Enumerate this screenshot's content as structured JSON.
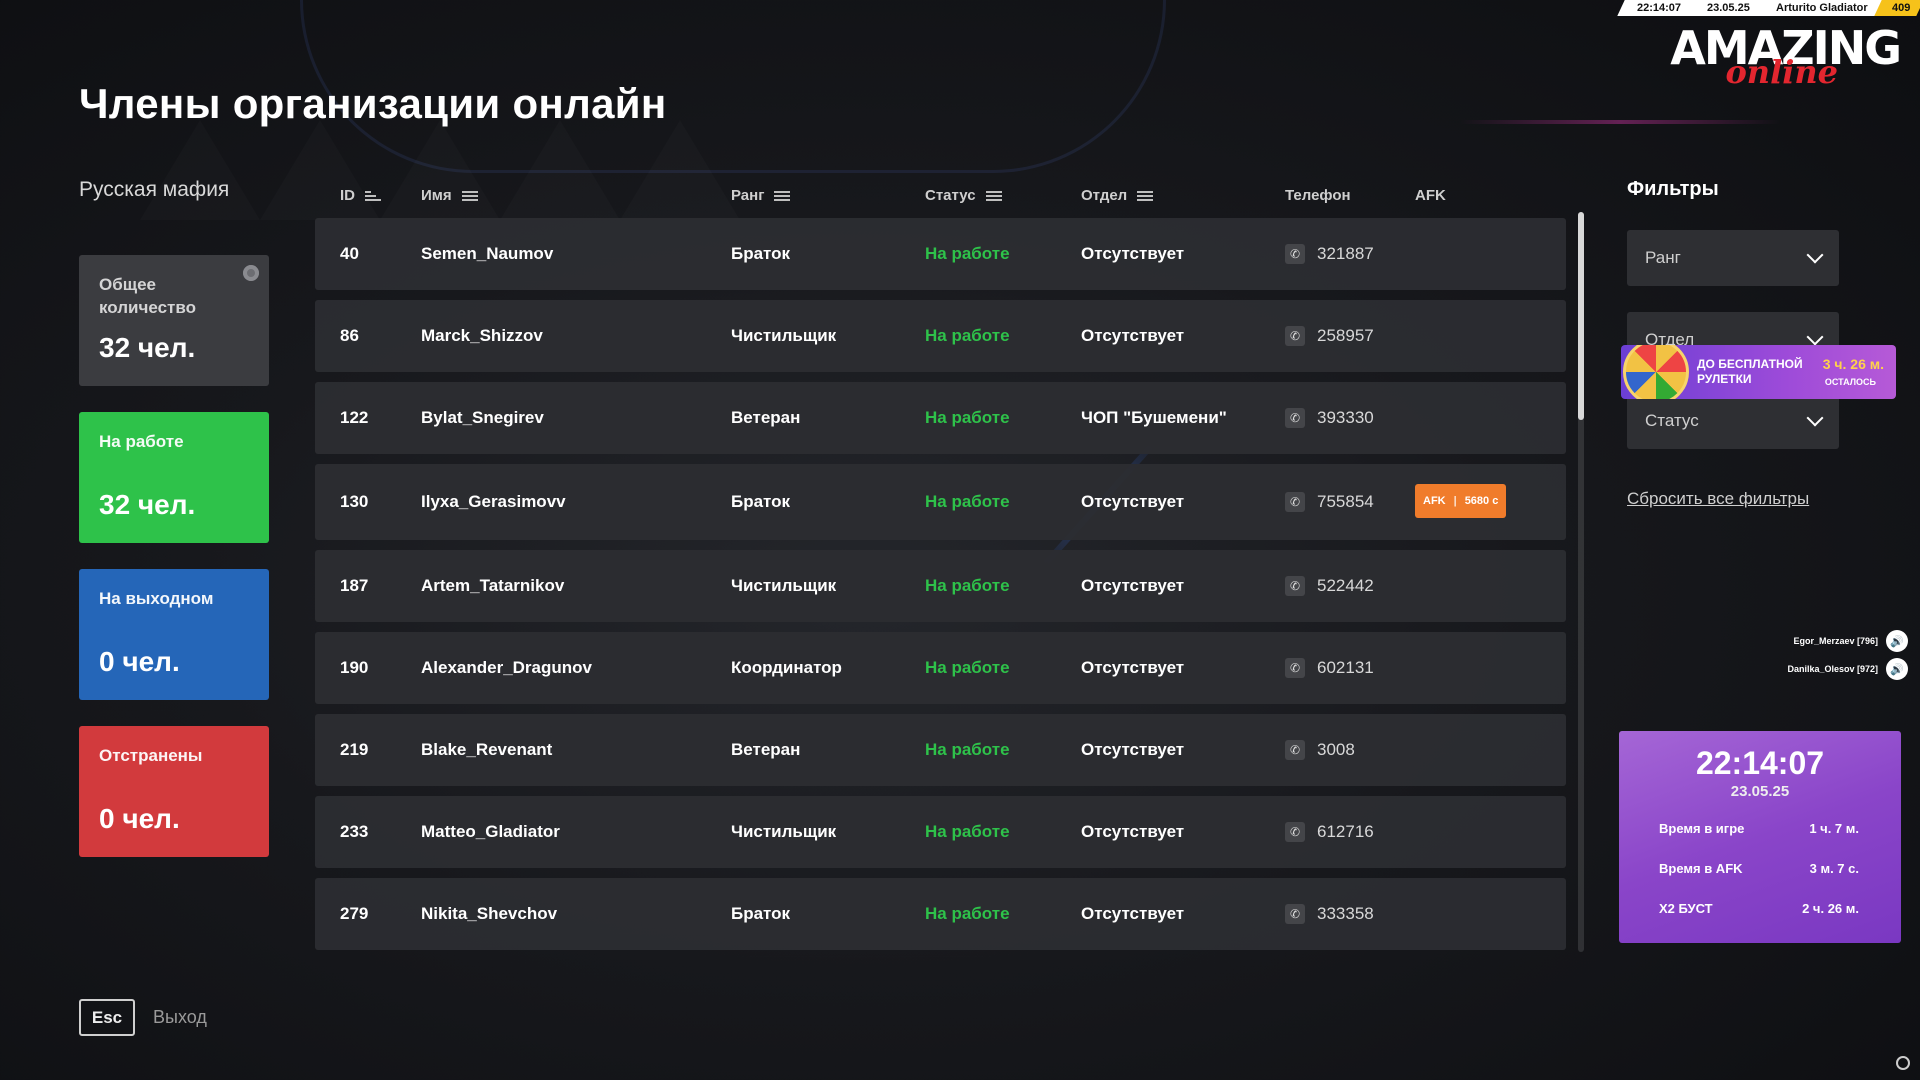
{
  "hud": {
    "time": "22:14:07",
    "date": "23.05.25",
    "player": "Arturito Gladiator",
    "id": "409"
  },
  "logo": {
    "line1": "AMAZING",
    "line2": "online"
  },
  "page": {
    "title": "Члены организации онлайн",
    "org_name": "Русская мафия"
  },
  "stats": {
    "total": {
      "label": "Общее количество",
      "value": "32 чел."
    },
    "working": {
      "label": "На работе",
      "value": "32 чел."
    },
    "off": {
      "label": "На выходном",
      "value": "0 чел."
    },
    "banned": {
      "label": "Отстранены",
      "value": "0 чел."
    }
  },
  "columns": {
    "id": "ID",
    "name": "Имя",
    "rank": "Ранг",
    "status": "Статус",
    "dept": "Отдел",
    "phone": "Телефон",
    "afk": "AFK"
  },
  "rows": [
    {
      "id": "40",
      "name": "Semen_Naumov",
      "rank": "Браток",
      "status": "На работе",
      "dept": "Отсутствует",
      "phone": "321887"
    },
    {
      "id": "86",
      "name": "Marck_Shizzov",
      "rank": "Чистильщик",
      "status": "На работе",
      "dept": "Отсутствует",
      "phone": "258957"
    },
    {
      "id": "122",
      "name": "Bylat_Snegirev",
      "rank": "Ветеран",
      "status": "На работе",
      "dept": "ЧОП \"Бушемени\"",
      "phone": "393330"
    },
    {
      "id": "130",
      "name": "Ilyxa_Gerasimovv",
      "rank": "Браток",
      "status": "На работе",
      "dept": "Отсутствует",
      "phone": "755854",
      "afk": {
        "label": "AFK",
        "time": "5680 с"
      }
    },
    {
      "id": "187",
      "name": "Artem_Tatarnikov",
      "rank": "Чистильщик",
      "status": "На работе",
      "dept": "Отсутствует",
      "phone": "522442"
    },
    {
      "id": "190",
      "name": "Alexander_Dragunov",
      "rank": "Координатор",
      "status": "На работе",
      "dept": "Отсутствует",
      "phone": "602131"
    },
    {
      "id": "219",
      "name": "Blake_Revenant",
      "rank": "Ветеран",
      "status": "На работе",
      "dept": "Отсутствует",
      "phone": "3008"
    },
    {
      "id": "233",
      "name": "Matteo_Gladiator",
      "rank": "Чистильщик",
      "status": "На работе",
      "dept": "Отсутствует",
      "phone": "612716"
    },
    {
      "id": "279",
      "name": "Nikita_Shevchov",
      "rank": "Браток",
      "status": "На работе",
      "dept": "Отсутствует",
      "phone": "333358"
    }
  ],
  "filters": {
    "title": "Фильтры",
    "rank": "Ранг",
    "dept": "Отдел",
    "status": "Статус",
    "reset": "Сбросить все фильтры"
  },
  "roulette": {
    "text": "ДО БЕСПЛАТНОЙ РУЛЕТКИ",
    "time": "3 ч. 26 м.",
    "rest": "ОСТАЛОСЬ"
  },
  "voice": [
    {
      "name": "Egor_Merzaev [796]"
    },
    {
      "name": "Danilka_Olesov [972]"
    }
  ],
  "clock": {
    "time": "22:14:07",
    "date": "23.05.25",
    "rows": [
      {
        "label": "Время в игре",
        "value": "1 ч. 7 м."
      },
      {
        "label": "Время в AFK",
        "value": "3 м. 7 с."
      },
      {
        "label": "X2 БУСТ",
        "value": "2 ч. 26 м."
      }
    ]
  },
  "footer": {
    "esc_key": "Esc",
    "esc_label": "Выход"
  },
  "colors": {
    "green": "#2ec24a",
    "blue": "#2566b8",
    "red": "#d23a3d",
    "orange": "#f07c2b",
    "purple": "#8a45c9"
  }
}
